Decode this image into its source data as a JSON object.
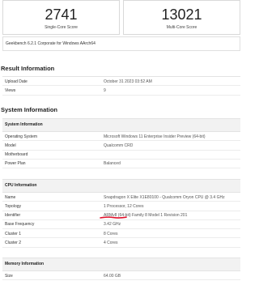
{
  "scores": {
    "single_core": {
      "value": "2741",
      "label": "Single-Core Score"
    },
    "multi_core": {
      "value": "13021",
      "label": "Multi-Core Score"
    }
  },
  "version": "Geekbench 6.2.1 Corporate for Windows AArch64",
  "result_information": {
    "title": "Result Information",
    "rows": [
      {
        "label": "Upload Date",
        "value": "October 31 2023 03:52 AM"
      },
      {
        "label": "Views",
        "value": "9"
      }
    ]
  },
  "system_information": {
    "title": "System Information",
    "system_table": {
      "header": "System Information",
      "rows": [
        {
          "label": "Operating System",
          "value": "Microsoft Windows 11 Enterprise Insider Preview (64-bit)"
        },
        {
          "label": "Model",
          "value": "Qualcomm CRD"
        },
        {
          "label": "Motherboard",
          "value": ""
        },
        {
          "label": "Power Plan",
          "value": "Balanced"
        }
      ]
    },
    "cpu_table": {
      "header": "CPU Information",
      "rows": [
        {
          "label": "Name",
          "value": "Snapdragon X Elite X1E80100 - Qualcomm Oryon CPU @ 3.4 GHz"
        },
        {
          "label": "Topology",
          "value": "1 Processor, 12 Cores"
        },
        {
          "label": "Identifier",
          "value": "ARMv8 (64-bit) Family 8 Model 1 Revision 201"
        },
        {
          "label": "Base Frequency",
          "value": "3.42 GHz"
        },
        {
          "label": "Cluster 1",
          "value": "8 Cores"
        },
        {
          "label": "Cluster 2",
          "value": "4 Cores"
        }
      ]
    },
    "memory_table": {
      "header": "Memory Information",
      "rows": [
        {
          "label": "Size",
          "value": "64.00 GB"
        }
      ]
    }
  },
  "colors": {
    "underline_annotation": "#e0112b",
    "subheader_bg": "#f2f2f2"
  }
}
